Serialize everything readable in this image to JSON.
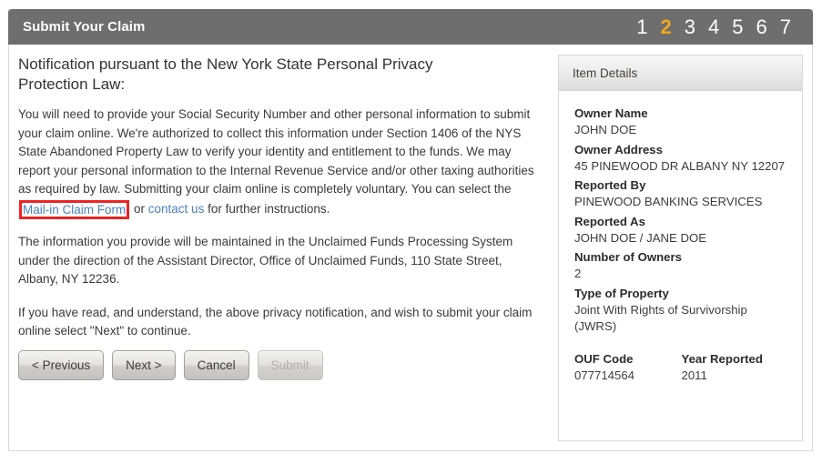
{
  "header": {
    "title": "Submit Your Claim",
    "steps": [
      "1",
      "2",
      "3",
      "4",
      "5",
      "6",
      "7"
    ],
    "active_step": "2",
    "bar_color": "#6d6e6d",
    "active_step_color": "#f0a81e"
  },
  "content": {
    "heading": "Notification pursuant to the New York State Personal Privacy Protection Law:",
    "para1_before_link": "You will need to provide your Social Security Number and other personal information to submit your claim online. We're authorized to collect this information under Section 1406 of the NYS State Abandoned Property Law to verify your identity and entitlement to the funds. We may report your personal information to the Internal Revenue Service and/or other taxing authorities as required by law. Submitting your claim online is completely voluntary. You can select the ",
    "link_mail_in": "Mail-in Claim Form",
    "para1_between_links": " or ",
    "link_contact_us": "contact us",
    "para1_after_link": " for further instructions.",
    "para2": "The information you provide will be maintained in the Unclaimed Funds Processing System under the direction of the Assistant Director, Office of Unclaimed Funds, 110 State Street, Albany, NY 12236.",
    "para3": "If you have read, and understand, the above privacy notification, and wish to submit your claim online select \"Next\" to continue.",
    "link_color": "#4a7fbd",
    "annotation_color": "#ee2222"
  },
  "buttons": {
    "previous": "< Previous",
    "next": "Next >",
    "cancel": "Cancel",
    "submit": "Submit",
    "submit_disabled": true
  },
  "item_details": {
    "panel_title": "Item Details",
    "fields": [
      {
        "label": "Owner Name",
        "value": "JOHN DOE"
      },
      {
        "label": "Owner Address",
        "value": "45 PINEWOOD DR ALBANY NY 12207"
      },
      {
        "label": "Reported By",
        "value": "PINEWOOD BANKING SERVICES"
      },
      {
        "label": "Reported As",
        "value": "JOHN DOE / JANE DOE"
      },
      {
        "label": "Number of Owners",
        "value": "2"
      },
      {
        "label": "Type of Property",
        "value": "Joint With Rights of Survivorship (JWRS)"
      }
    ],
    "footer_row": {
      "ouf_code_label": "OUF Code",
      "ouf_code_value": "077714564",
      "year_reported_label": "Year Reported",
      "year_reported_value": "2011"
    }
  }
}
